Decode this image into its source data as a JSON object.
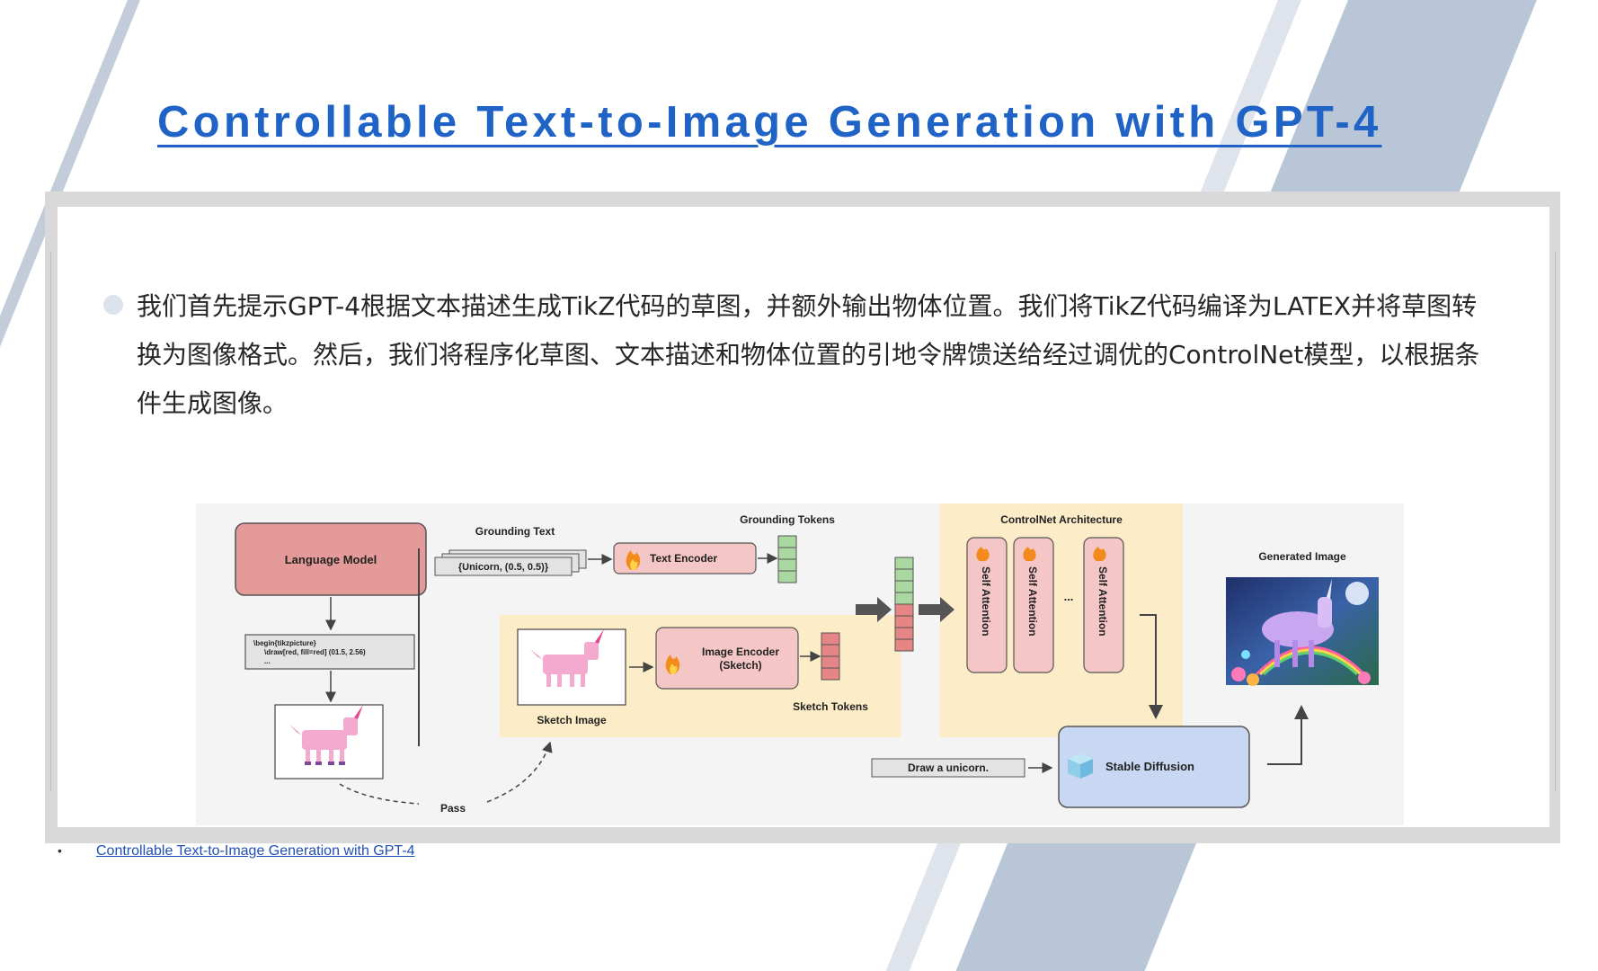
{
  "slide": {
    "title": "Controllable Text-to-Image Generation with GPT-4",
    "bullet": "我们首先提示GPT-4根据文本描述生成TikZ代码的草图，并额外输出物体位置。我们将TikZ代码编译为LATEX并将草图转换为图像格式。然后，我们将程序化草图、文本描述和物体位置的引地令牌馈送给经过调优的ControlNet模型，以根据条件生成图像。",
    "footnote_bullet": "•",
    "footnote_link": "Controllable Text-to-Image Generation with GPT-4"
  },
  "diagram": {
    "language_model": "Language Model",
    "tikz_line1": "\\begin{tikzpicture}",
    "tikz_line2": "\\draw[red, fill=red] (01.5, 2.56)",
    "tikz_line3": "...",
    "grounding_text_label": "Grounding Text",
    "grounding_text_value": "{Unicorn, (0.5, 0.5)}",
    "text_encoder": "Text Encoder",
    "image_encoder_line1": "Image Encoder",
    "image_encoder_line2": "(Sketch)",
    "sketch_image_label": "Sketch Image",
    "grounding_tokens_label": "Grounding Tokens",
    "sketch_tokens_label": "Sketch Tokens",
    "controlnet_label": "ControlNet Architecture",
    "self_attention_1": "Self Attention",
    "self_attention_2": "Self Attention",
    "self_attention_ellipsis": "...",
    "self_attention_3": "Self Attention",
    "generated_image_label": "Generated Image",
    "prompt_box": "Draw a unicorn.",
    "stable_diffusion": "Stable Diffusion",
    "pass_label": "Pass"
  },
  "colors": {
    "title_blue": "#1f63c6",
    "stripe_navy": "#b9c6d8",
    "controlnet_bg": "#fdecc8",
    "language_model_fill": "#e59a9a",
    "encoder_fill": "#f5c6c6",
    "token_green": "#a9d8a0",
    "token_red": "#e58585",
    "stable_diffusion_fill": "#c8d8f2"
  },
  "icons": {
    "encoder_icon": "flame-icon",
    "stable_diffusion_icon": "ice-cube-icon",
    "sketch_image": "pink-unicorn-sketch",
    "generated_image": "unicorn-rainbow-painting"
  }
}
